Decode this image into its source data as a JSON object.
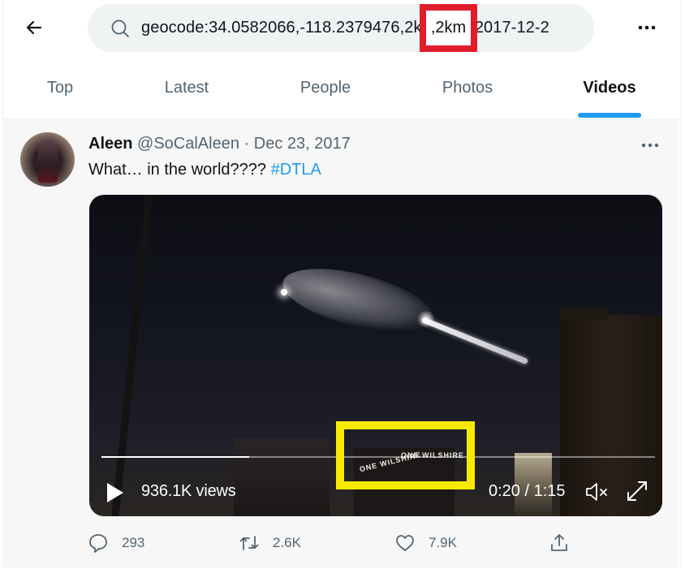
{
  "header": {
    "back_label": "Back",
    "search": {
      "value": "geocode:34.0582066,-118.2379476,2km until:2017-12-2",
      "display_value": "geocode:34.0582066,-118.237947",
      "highlighted_fragment": ",2km",
      "trailing_fragment": "ntil:2017-12-2"
    },
    "more_label": "More"
  },
  "tabs": [
    {
      "label": "Top",
      "active": false
    },
    {
      "label": "Latest",
      "active": false
    },
    {
      "label": "People",
      "active": false
    },
    {
      "label": "Photos",
      "active": false
    },
    {
      "label": "Videos",
      "active": true
    }
  ],
  "tweet": {
    "author_name": "Aleen",
    "author_handle": "@SoCalAleen",
    "separator": "·",
    "date": "Dec 23, 2017",
    "text": "What… in the world????",
    "hashtag": "#DTLA",
    "video": {
      "views": "936.1K views",
      "time": "0:20 / 1:15",
      "progress_fraction": 0.267,
      "signage": [
        "ONE WILSHIRE",
        "ONE WILSHIRE"
      ]
    },
    "actions": {
      "replies": "293",
      "retweets": "2.6K",
      "likes": "7.9K"
    }
  },
  "annotations": {
    "red_box_color": "#e21d2a",
    "yellow_box_color": "#f7ea00",
    "accent_color": "#1d9bf0"
  }
}
